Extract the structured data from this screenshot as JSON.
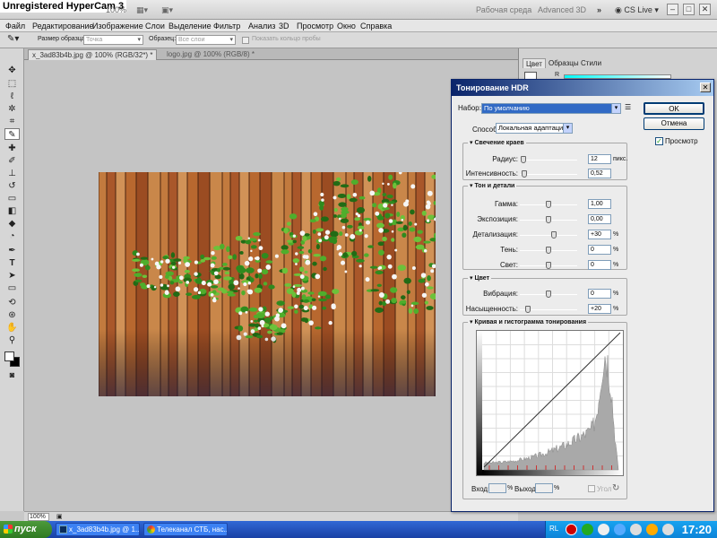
{
  "recorder_watermark": "Unregistered HyperCam 3",
  "app": {
    "zoom_level": "100%",
    "workspace_label": "Рабочая среда",
    "advanced_label": "Advanced 3D",
    "cs_live_label": "CS Live",
    "window_controls": [
      "–",
      "□",
      "✕"
    ]
  },
  "menu": [
    "Файл",
    "Редактирование",
    "Изображение",
    "Слои",
    "Выделение",
    "Фильтр",
    "Анализ",
    "3D",
    "Просмотр",
    "Окно",
    "Справка"
  ],
  "options_bar": {
    "sample_size_label": "Размер образца:",
    "sample_size_value": "Точка",
    "sample_label": "Образец:",
    "sample_value": "Все слои",
    "show_ring_label": "Показать кольцо пробы"
  },
  "doc_tabs": [
    {
      "label": "x_3ad83b4b.jpg @ 100% (RGB/32*) *",
      "active": true
    },
    {
      "label": "logo.jpg @ 100% (RGB/8) *",
      "active": false
    }
  ],
  "panel_tabs": [
    "Цвет",
    "Образцы",
    "Стили"
  ],
  "panel_channel": "R",
  "status": {
    "zoom": "100%"
  },
  "dialog": {
    "title": "Тонирование HDR",
    "preset_label": "Набор:",
    "preset_value": "По умолчанию",
    "method_label": "Способ:",
    "method_value": "Локальная адаптация",
    "ok_label": "OK",
    "cancel_label": "Отмена",
    "preview_label": "Просмотр",
    "preview_checked": true,
    "groups": {
      "edge_glow": {
        "title": "Свечение краев",
        "rows": [
          {
            "label": "Радиус:",
            "value": "12",
            "unit": "пикс.",
            "position": 0.02
          },
          {
            "label": "Интенсивность:",
            "value": "0,52",
            "unit": "",
            "position": 0.04
          }
        ]
      },
      "tone_detail": {
        "title": "Тон и детали",
        "rows": [
          {
            "label": "Гамма:",
            "value": "1,00",
            "unit": "",
            "position": 0.5
          },
          {
            "label": "Экспозиция:",
            "value": "0,00",
            "unit": "",
            "position": 0.5
          },
          {
            "label": "Детализация:",
            "value": "+30",
            "unit": "%",
            "position": 0.6
          },
          {
            "label": "Тень:",
            "value": "0",
            "unit": "%",
            "position": 0.5
          },
          {
            "label": "Свет:",
            "value": "0",
            "unit": "%",
            "position": 0.5
          }
        ]
      },
      "color": {
        "title": "Цвет",
        "rows": [
          {
            "label": "Вибрация:",
            "value": "0",
            "unit": "%",
            "position": 0.5
          },
          {
            "label": "Насыщенность:",
            "value": "+20",
            "unit": "%",
            "position": 0.1
          }
        ]
      },
      "curve": {
        "title": "Кривая и гистограмма тонирования",
        "input_label": "Вход:",
        "input_unit": "%",
        "output_label": "Выход:",
        "output_unit": "%",
        "corner_label": "Угол"
      }
    }
  },
  "taskbar": {
    "start_label": "пуск",
    "tasks": [
      "x_3ad83b4b.jpg @ 1...",
      "Телеканал СТБ, нас..."
    ],
    "lang": "RL",
    "clock": "17:20"
  }
}
